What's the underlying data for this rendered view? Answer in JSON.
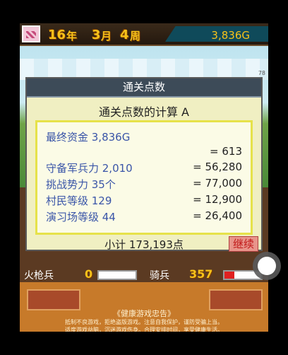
{
  "topbar": {
    "year": "16",
    "year_unit": "年",
    "month": "3",
    "month_unit": "月",
    "week": "4",
    "week_unit": "周",
    "money": "3,836G"
  },
  "scene": {
    "level_tag": "78"
  },
  "dialog": {
    "title": "通关点数",
    "subtitle": "通关点数的计算 A",
    "rows": [
      {
        "label": "最终资金  3,836G",
        "value": ""
      },
      {
        "label": "",
        "value": "= 613"
      },
      {
        "label": "守备军兵力  2,010",
        "value": "= 56,280"
      },
      {
        "label": "挑战势力  35个",
        "value": "= 77,000"
      },
      {
        "label": "村民等级    129",
        "value": "= 12,900"
      },
      {
        "label": "演习场等级  44",
        "value": "= 26,400"
      }
    ],
    "subtotal": "小计 173,193点",
    "continue_label": "继续"
  },
  "stats": {
    "row1_left_label": "...",
    "rifle_label": "火枪兵",
    "rifle_count": "0",
    "cavalry_label": "骑兵",
    "cavalry_count": "357"
  },
  "footer": {
    "title": "《健康游戏忠告》",
    "line1": "抵制不良游戏，拒绝盗版游戏。注意自我保护，谨防受骗上当。",
    "line2": "适度游戏益脑，沉迷游戏伤身。合理安排时间，享受健康生活。"
  },
  "colors": {
    "accent_gold": "#f6c21a",
    "label_blue": "#3a55a8",
    "continue_red": "#c01818"
  }
}
